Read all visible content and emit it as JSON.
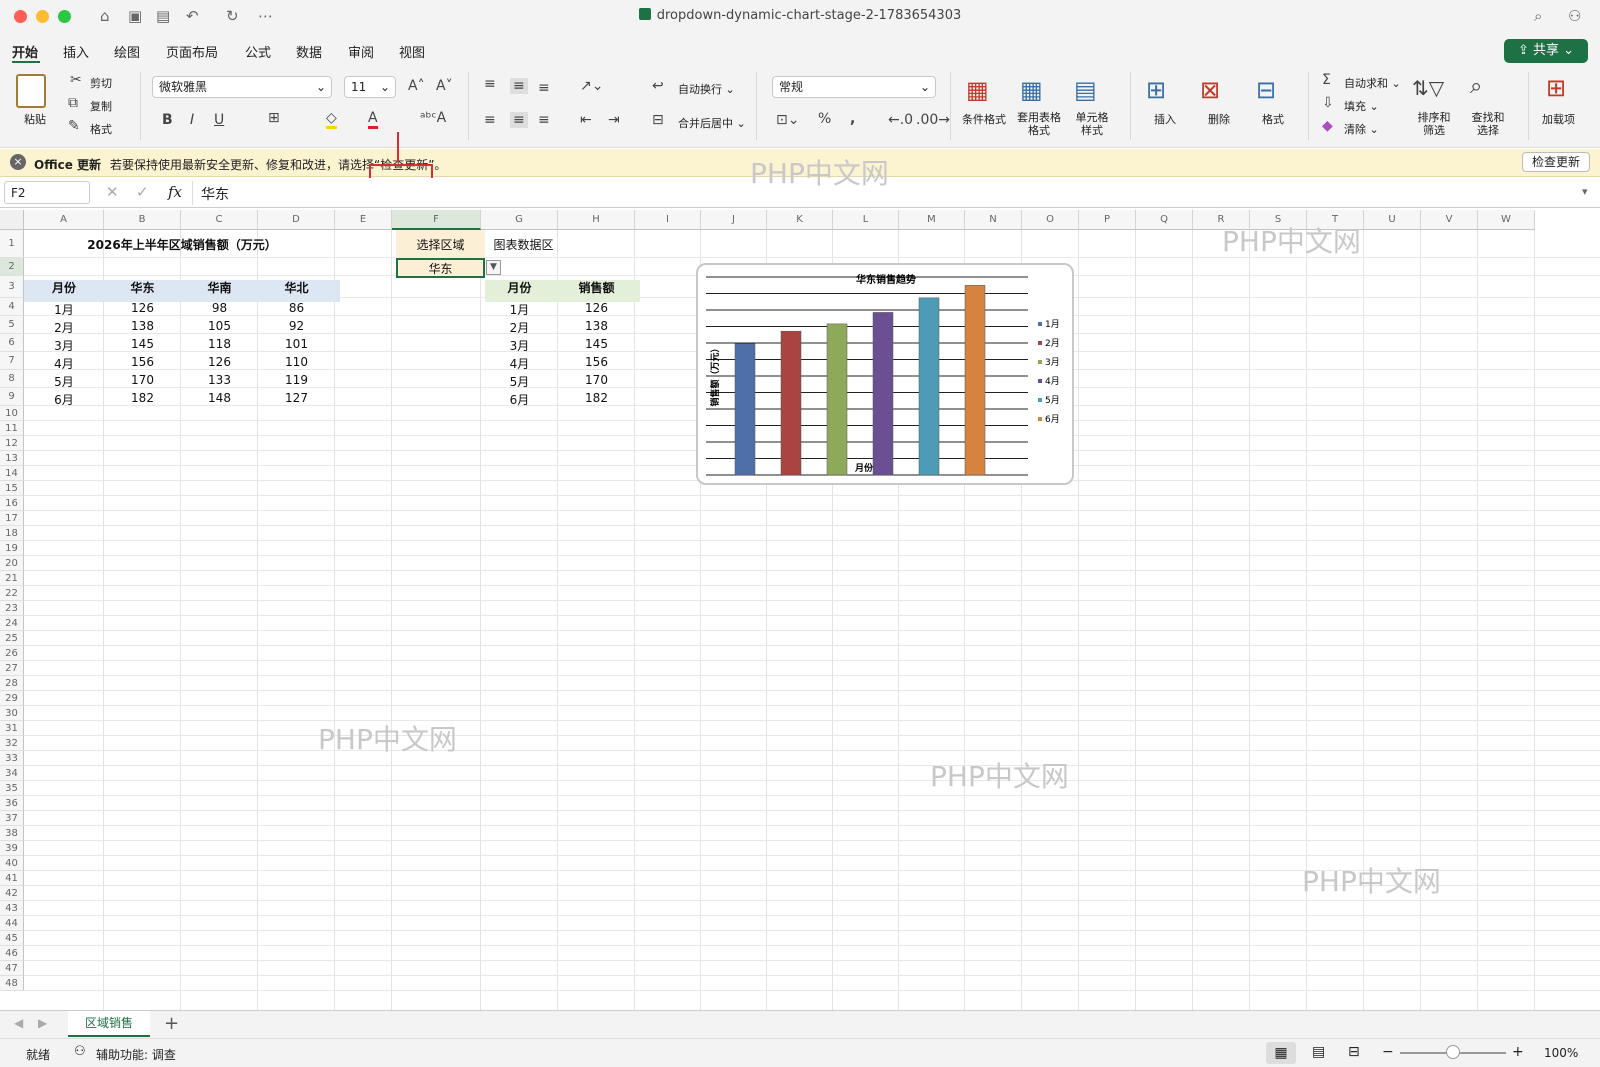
{
  "window": {
    "title": "dropdown-dynamic-chart-stage-2-1783654303"
  },
  "tabs": [
    "开始",
    "插入",
    "绘图",
    "页面布局",
    "公式",
    "数据",
    "审阅",
    "视图"
  ],
  "share_label": "共享",
  "ribbon": {
    "paste": "粘贴",
    "cut": "剪切",
    "copy": "复制",
    "format_painter": "格式",
    "font_name": "微软雅黑",
    "font_size": "11",
    "bold": "B",
    "italic": "I",
    "underline": "U",
    "wrap_text": "自动换行",
    "merge_center": "合并后居中",
    "number_format": "常规",
    "percent": "%",
    "comma": ",",
    "cond_format": "条件格式",
    "table_format": "套用表格格式",
    "cell_style": "单元格样式",
    "insert": "插入",
    "delete": "删除",
    "format": "格式",
    "autosum": "自动求和",
    "fill": "填充",
    "clear": "清除",
    "sort_filter": "排序和筛选",
    "find_select": "查找和选择",
    "addins": "加载项"
  },
  "message_bar": {
    "title": "Office 更新",
    "text": "若要保持使用最新安全更新、修复和改进，请选择“检查更新”。",
    "button": "检查更新"
  },
  "formula_bar": {
    "name_box": "F2",
    "fx": "fx",
    "content": "华东"
  },
  "columns": [
    "A",
    "B",
    "C",
    "D",
    "E",
    "F",
    "G",
    "H",
    "I",
    "J",
    "K",
    "L",
    "M",
    "N",
    "O",
    "P",
    "Q",
    "R",
    "S",
    "T",
    "U",
    "V",
    "W"
  ],
  "rows": [
    "1",
    "2",
    "3",
    "4",
    "5",
    "6",
    "7",
    "8",
    "9",
    "10",
    "11",
    "12",
    "13",
    "14",
    "15",
    "16",
    "17",
    "18",
    "19",
    "20",
    "21",
    "22",
    "23",
    "24",
    "25",
    "26",
    "27",
    "28",
    "29",
    "30",
    "31",
    "32",
    "33",
    "34",
    "35",
    "36",
    "37",
    "38",
    "39",
    "40",
    "41",
    "42",
    "43",
    "44",
    "45",
    "46",
    "47",
    "48"
  ],
  "table": {
    "title": "2026年上半年区域销售额（万元）",
    "headers": [
      "月份",
      "华东",
      "华南",
      "华北"
    ],
    "rows": [
      [
        "1月",
        "126",
        "98",
        "86"
      ],
      [
        "2月",
        "138",
        "105",
        "92"
      ],
      [
        "3月",
        "145",
        "118",
        "101"
      ],
      [
        "4月",
        "156",
        "126",
        "110"
      ],
      [
        "5月",
        "170",
        "133",
        "119"
      ],
      [
        "6月",
        "182",
        "148",
        "127"
      ]
    ]
  },
  "selector": {
    "label": "选择区域",
    "value": "华东"
  },
  "chart_area": {
    "label": "图表数据区",
    "headers": [
      "月份",
      "销售额"
    ],
    "rows": [
      [
        "1月",
        "126"
      ],
      [
        "2月",
        "138"
      ],
      [
        "3月",
        "145"
      ],
      [
        "4月",
        "156"
      ],
      [
        "5月",
        "170"
      ],
      [
        "6月",
        "182"
      ]
    ]
  },
  "chart_data": {
    "type": "bar",
    "title": "华东销售趋势",
    "xlabel": "月份",
    "ylabel": "销售额（万元）",
    "categories": [
      "1月",
      "2月",
      "3月",
      "4月",
      "5月",
      "6月"
    ],
    "values": [
      126,
      138,
      145,
      156,
      170,
      182
    ],
    "colors": [
      "#4f6fa8",
      "#a94442",
      "#8fa95a",
      "#6a4f93",
      "#4b9cb4",
      "#d5833f"
    ],
    "legend_position": "right",
    "grid": true
  },
  "watermark": "PHP中文网",
  "sheet_tab": "区域销售",
  "status": {
    "ready": "就绪",
    "accessibility": "辅助功能: 调查",
    "zoom": "100%"
  }
}
